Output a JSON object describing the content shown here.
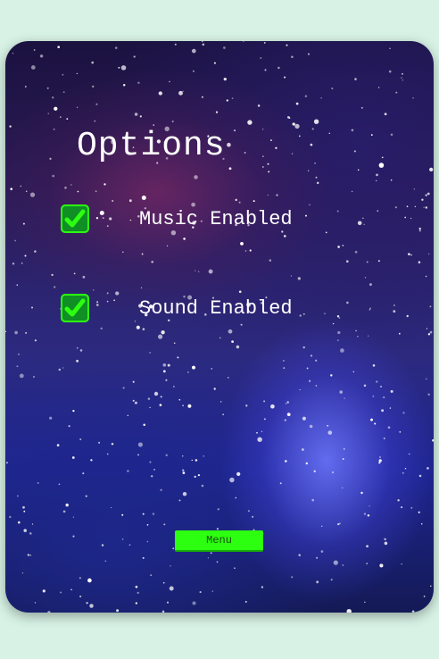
{
  "screen": {
    "title": "Options"
  },
  "options": [
    {
      "label": "Music Enabled",
      "checked": true
    },
    {
      "label": "Sound Enabled",
      "checked": true
    }
  ],
  "menu_button": {
    "label": "Menu"
  },
  "colors": {
    "page_background": "#d8f3e6",
    "accent_green": "#2dff11",
    "checkbox_fill": "#0f8f24",
    "text": "#ffffff"
  },
  "icons": {
    "checkbox": "checkmark-icon"
  }
}
